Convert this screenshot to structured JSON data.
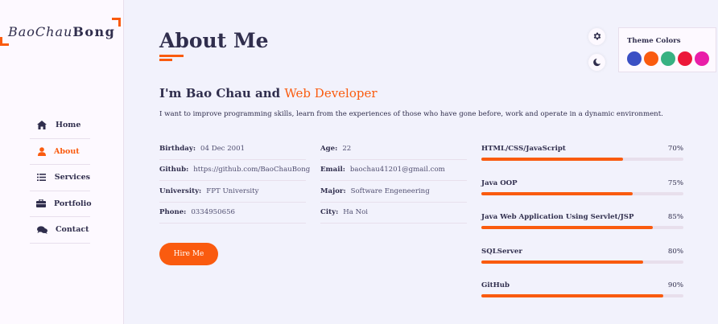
{
  "brand": {
    "part1": "BaoChau",
    "part2": "Bong"
  },
  "nav": {
    "items": [
      {
        "label": "Home",
        "icon": "home-icon"
      },
      {
        "label": "About",
        "icon": "user-icon",
        "active": true
      },
      {
        "label": "Services",
        "icon": "list-icon"
      },
      {
        "label": "Portfolio",
        "icon": "briefcase-icon"
      },
      {
        "label": "Contact",
        "icon": "comments-icon"
      }
    ]
  },
  "about": {
    "title": "About Me",
    "headline_prefix": "I'm Bao Chau and ",
    "headline_role": "Web Developer",
    "intro": "I want to improve programming skills, learn from the experiences of those who have gone before, work and operate in a dynamic environment.",
    "info_left": [
      {
        "key": "Birthday:",
        "value": "04 Dec 2001"
      },
      {
        "key": "Github:",
        "value": "https://github.com/BaoChauBong"
      },
      {
        "key": "University:",
        "value": "FPT University"
      },
      {
        "key": "Phone:",
        "value": "0334950656"
      }
    ],
    "info_right": [
      {
        "key": "Age:",
        "value": "22"
      },
      {
        "key": "Email:",
        "value": "baochau41201@gmail.com"
      },
      {
        "key": "Major:",
        "value": "Software Engeneering"
      },
      {
        "key": "City:",
        "value": "Ha Noi"
      }
    ],
    "hire_label": "Hire Me"
  },
  "skills": [
    {
      "name": "HTML/CSS/JavaScript",
      "percent_label": "70%",
      "level": 0.7
    },
    {
      "name": "Java OOP",
      "percent_label": "75%",
      "level": 0.75
    },
    {
      "name": "Java Web Application Using Servlet/JSP",
      "percent_label": "85%",
      "level": 0.85
    },
    {
      "name": "SQLServer",
      "percent_label": "80%",
      "level": 0.8
    },
    {
      "name": "GitHub",
      "percent_label": "90%",
      "level": 0.9
    }
  ],
  "switcher": {
    "title": "Theme Colors",
    "colors": [
      "#3a4fc4",
      "#fa5b0f",
      "#37b182",
      "#ec1839",
      "#e91ea8"
    ],
    "gear_icon": "gear-icon",
    "moon_icon": "moon-icon"
  },
  "colors": {
    "accent": "#fa5b0f",
    "text": "#302e4d"
  }
}
